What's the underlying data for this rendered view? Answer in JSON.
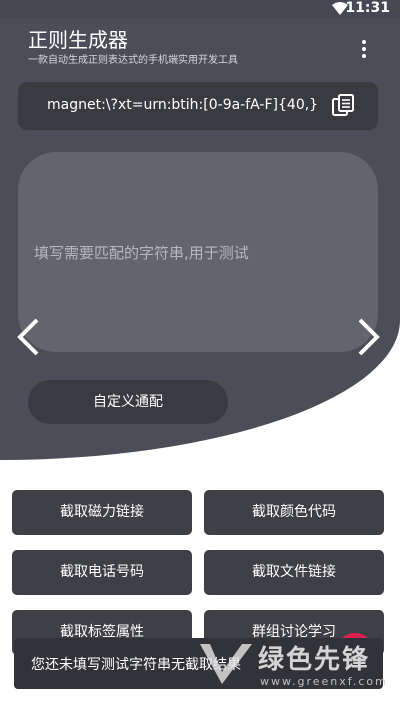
{
  "status_bar": {
    "time": "11:31",
    "wifi_icon": "wifi-icon"
  },
  "app": {
    "title": "正则生成器",
    "subtitle": "一款自动生成正则表达式的手机端实用开发工具",
    "menu_icon": "more-vert-icon"
  },
  "regex": {
    "value": "magnet:\\?xt=urn:btih:[0-9a-fA-F]{40,}",
    "copy_icon": "copy-icon"
  },
  "test_input": {
    "placeholder": "填写需要匹配的字符串,用于测试"
  },
  "navigation": {
    "prev_icon": "chevron-left-icon",
    "next_icon": "chevron-right-icon"
  },
  "custom_button": {
    "label": "自定义通配"
  },
  "actions": [
    {
      "label": "截取磁力链接"
    },
    {
      "label": "截取颜色代码"
    },
    {
      "label": "截取电话号码"
    },
    {
      "label": "截取文件链接"
    },
    {
      "label": "截取标签属性"
    },
    {
      "label": "群组讨论学习"
    }
  ],
  "toast": {
    "message": "您还未填写测试字符串无截取结果"
  },
  "watermark": {
    "text": "绿色先锋",
    "subtext": "www.greenxf.com"
  },
  "colors": {
    "hero_background": "#4b4d58",
    "button_background": "#3f4046",
    "fab_accent": "#e0214f"
  }
}
